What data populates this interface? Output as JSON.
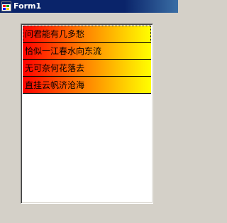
{
  "window": {
    "title": "Form1",
    "title_bar_color": "#0a246a",
    "background_color": "#d4d0c8",
    "icon": "windows-form-icon"
  },
  "listbox": {
    "item_gradient": [
      "#ff0000",
      "#ffff00"
    ],
    "items": [
      {
        "label": "问君能有几多愁"
      },
      {
        "label": "恰似一江春水向东流"
      },
      {
        "label": "无可奈何花落去"
      },
      {
        "label": "直挂云帆济沧海"
      }
    ]
  }
}
